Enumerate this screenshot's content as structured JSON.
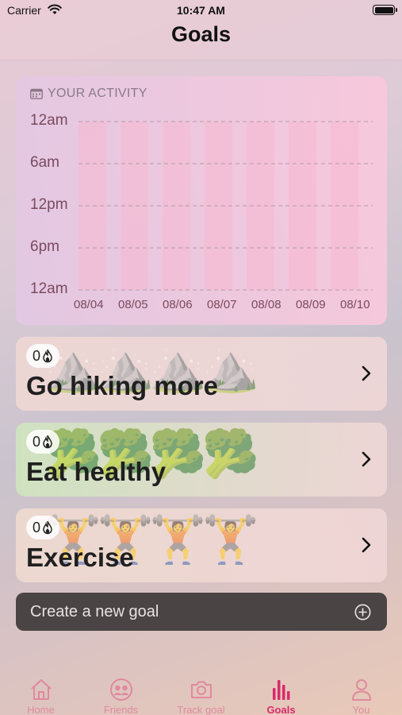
{
  "status_bar": {
    "carrier": "Carrier",
    "time": "10:47 AM"
  },
  "nav": {
    "title": "Goals"
  },
  "activity": {
    "title": "YOUR ACTIVITY",
    "y_labels": [
      "12am",
      "6am",
      "12pm",
      "6pm",
      "12am"
    ],
    "x_labels": [
      "08/04",
      "08/05",
      "08/06",
      "08/07",
      "08/08",
      "08/09",
      "08/10"
    ]
  },
  "goals": [
    {
      "count": "0",
      "title": "Go hiking more",
      "emoji": "⛰️⛰️⛰️⛰️",
      "icon": "flame-icon",
      "color": "#ecd6d4"
    },
    {
      "count": "0",
      "title": "Eat healthy",
      "emoji": "🥦🥦🥦🥦",
      "icon": "flame-icon",
      "color": "#cfe2c0"
    },
    {
      "count": "0",
      "title": "Exercise",
      "emoji": "🏋️🏋️🏋️🏋️",
      "icon": "flame-icon",
      "color": "#ecd8cf"
    }
  ],
  "create_goal": {
    "label": "Create a new goal"
  },
  "tabs": [
    {
      "label": "Home",
      "icon": "home-icon"
    },
    {
      "label": "Friends",
      "icon": "friends-icon"
    },
    {
      "label": "Track goal",
      "icon": "camera-icon"
    },
    {
      "label": "Goals",
      "icon": "bar-chart-icon",
      "active": true
    },
    {
      "label": "You",
      "icon": "person-icon"
    }
  ],
  "colors": {
    "accent": "#d92a6a",
    "tab_inactive": "#e0899e",
    "chart_bar": "#f5b8cf"
  }
}
